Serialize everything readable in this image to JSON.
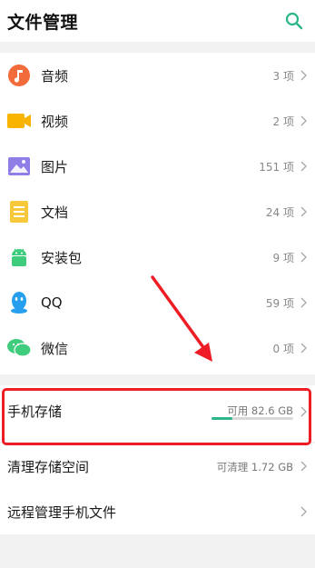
{
  "header": {
    "title": "文件管理",
    "search_icon": "search-icon"
  },
  "categories": [
    {
      "label": "音频",
      "count": "3 项",
      "icon": "music-icon",
      "color": "#f26b3a"
    },
    {
      "label": "视频",
      "count": "2 项",
      "icon": "video-icon",
      "color": "#f8b400"
    },
    {
      "label": "图片",
      "count": "151 项",
      "icon": "image-icon",
      "color": "#8f7ee6"
    },
    {
      "label": "文档",
      "count": "24 项",
      "icon": "document-icon",
      "color": "#f7c93a"
    },
    {
      "label": "安装包",
      "count": "9 项",
      "icon": "android-icon",
      "color": "#3fcd7d"
    },
    {
      "label": "QQ",
      "count": "59 项",
      "icon": "qq-icon",
      "color": "#26a0ee"
    },
    {
      "label": "微信",
      "count": "0 项",
      "icon": "wechat-icon",
      "color": "#3fcd7d"
    }
  ],
  "storage": {
    "label": "手机存储",
    "available": "可用 82.6 GB",
    "used_fraction": 0.25
  },
  "clean": {
    "label": "清理存储空间",
    "value": "可清理 1.72 GB"
  },
  "remote": {
    "label": "远程管理手机文件"
  },
  "colors": {
    "accent": "#2bb58a",
    "annotation": "#ee1c25"
  }
}
